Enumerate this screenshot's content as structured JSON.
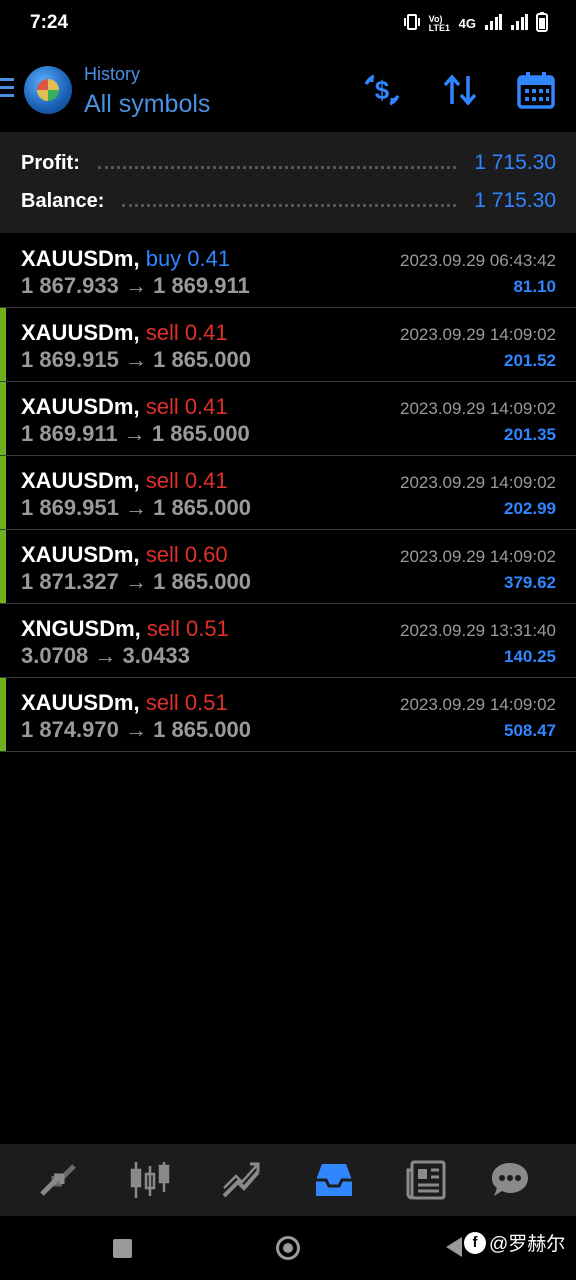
{
  "status": {
    "time": "7:24",
    "network": "4G",
    "volte": "Vo) LTE1"
  },
  "header": {
    "subtitle": "History",
    "title": "All symbols"
  },
  "summary": {
    "profit_label": "Profit:",
    "profit_value": "1 715.30",
    "balance_label": "Balance:",
    "balance_value": "1 715.30"
  },
  "deals": [
    {
      "symbol": "XAUUSDm,",
      "side": "buy 0.41",
      "prices": "1 867.933 → 1 869.911",
      "time": "2023.09.29 06:43:42",
      "profit": "81.10",
      "flag": false
    },
    {
      "symbol": "XAUUSDm,",
      "side": "sell 0.41",
      "prices": "1 869.915 → 1 865.000",
      "time": "2023.09.29 14:09:02",
      "profit": "201.52",
      "flag": true
    },
    {
      "symbol": "XAUUSDm,",
      "side": "sell 0.41",
      "prices": "1 869.911 → 1 865.000",
      "time": "2023.09.29 14:09:02",
      "profit": "201.35",
      "flag": true
    },
    {
      "symbol": "XAUUSDm,",
      "side": "sell 0.41",
      "prices": "1 869.951 → 1 865.000",
      "time": "2023.09.29 14:09:02",
      "profit": "202.99",
      "flag": true
    },
    {
      "symbol": "XAUUSDm,",
      "side": "sell 0.60",
      "prices": "1 871.327 → 1 865.000",
      "time": "2023.09.29 14:09:02",
      "profit": "379.62",
      "flag": true
    },
    {
      "symbol": "XNGUSDm,",
      "side": "sell 0.51",
      "prices": "3.0708 → 3.0433",
      "time": "2023.09.29 13:31:40",
      "profit": "140.25",
      "flag": false
    },
    {
      "symbol": "XAUUSDm,",
      "side": "sell 0.51",
      "prices": "1 874.970 → 1 865.000",
      "time": "2023.09.29 14:09:02",
      "profit": "508.47",
      "flag": true
    }
  ],
  "bottom_nav": [
    "quotes-icon",
    "chart-icon",
    "trade-icon",
    "history-icon",
    "news-icon",
    "chat-icon"
  ],
  "active_nav": "history-icon",
  "watermark": {
    "text": "@罗赫尔"
  },
  "colors": {
    "accent": "#2f86ff",
    "sell": "#e0302a",
    "flag": "#6fb01c",
    "muted": "#9a9a9a",
    "panel": "#1c1c1e"
  }
}
